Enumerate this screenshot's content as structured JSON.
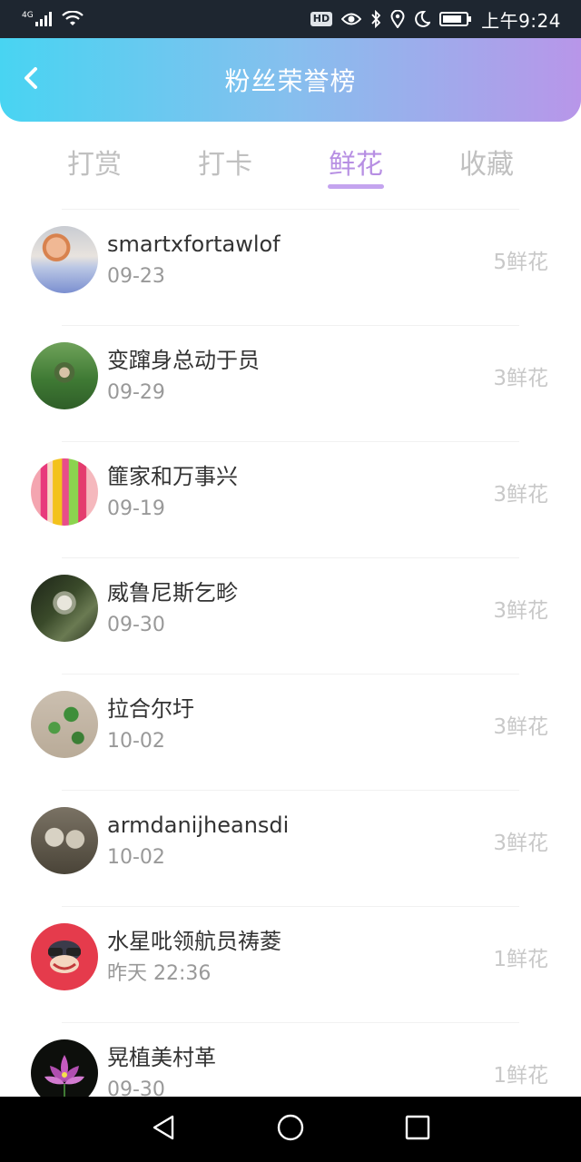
{
  "status_bar": {
    "network": "4G",
    "hd": "HD",
    "time": "上午9:24"
  },
  "header": {
    "title": "粉丝荣誉榜"
  },
  "tabs": [
    {
      "label": "打赏",
      "active": false
    },
    {
      "label": "打卡",
      "active": false
    },
    {
      "label": "鲜花",
      "active": true
    },
    {
      "label": "收藏",
      "active": false
    }
  ],
  "fans": [
    {
      "name": "smartxfortawlof",
      "date": "09-23",
      "amount": "5鲜花"
    },
    {
      "name": "变蹿身总动于员",
      "date": "09-29",
      "amount": "3鲜花"
    },
    {
      "name": "篚家和万事兴",
      "date": "09-19",
      "amount": "3鲜花"
    },
    {
      "name": "威鲁尼斯乞畛",
      "date": "09-30",
      "amount": "3鲜花"
    },
    {
      "name": "拉合尔圩",
      "date": "10-02",
      "amount": "3鲜花"
    },
    {
      "name": "armdanijheansdi",
      "date": "10-02",
      "amount": "3鲜花"
    },
    {
      "name": "水星吡领航员祷菱",
      "date": "昨天 22:36",
      "amount": "1鲜花"
    },
    {
      "name": "晃植美村革",
      "date": "09-30",
      "amount": "1鲜花"
    }
  ],
  "colors": {
    "accent": "#b78fe3",
    "header_gradient_start": "#48d4f2",
    "header_gradient_end": "#b896e9"
  }
}
